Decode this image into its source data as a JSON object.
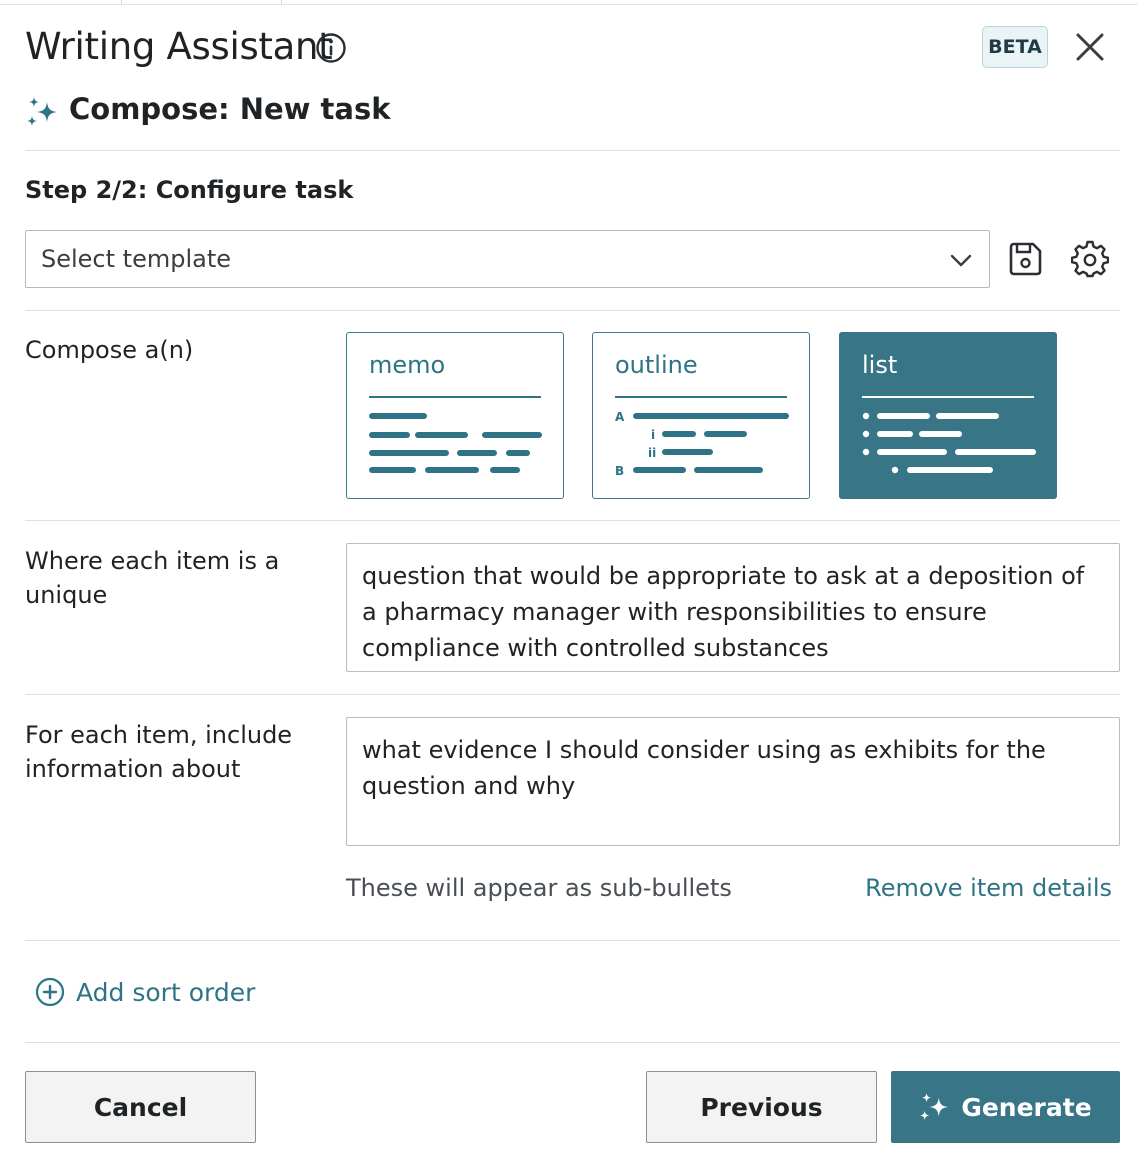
{
  "header": {
    "title": "Writing Assistant",
    "badge": "BETA",
    "subtitle": "Compose: New task"
  },
  "step": {
    "label": "Step 2/2: Configure task"
  },
  "template_select": {
    "value": "Select template"
  },
  "compose": {
    "label": "Compose a(n)",
    "options": [
      {
        "label": "memo",
        "selected": false
      },
      {
        "label": "outline",
        "selected": false
      },
      {
        "label": "list",
        "selected": true
      }
    ],
    "outline_markers": {
      "a": "A",
      "i": "i",
      "ii": "ii",
      "b": "B"
    }
  },
  "item_field": {
    "label": "Where each item is a unique",
    "value": "question that would be appropriate to ask at a deposition of a pharmacy manager with responsibilities to ensure compliance with controlled substances"
  },
  "details_field": {
    "label": "For each item, include information about",
    "value": "what evidence I should consider using as exhibits for the question and why",
    "hint": "These will appear as sub-bullets",
    "remove_link": "Remove item details"
  },
  "sort": {
    "add_label": "Add sort order"
  },
  "footer": {
    "cancel": "Cancel",
    "previous": "Previous",
    "generate": "Generate"
  },
  "colors": {
    "accent": "#377587",
    "accent_text": "#2f7486",
    "badge_bg": "#eaf4f6"
  }
}
